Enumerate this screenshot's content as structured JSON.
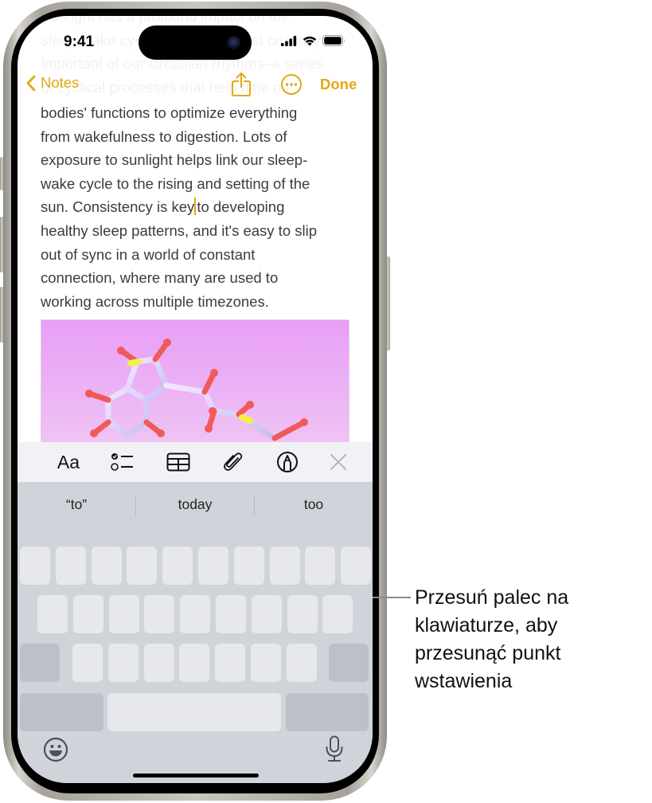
{
  "status_bar": {
    "time": "9:41",
    "icons": [
      "cellular-signal-icon",
      "wifi-icon",
      "battery-icon"
    ]
  },
  "nav": {
    "back_label": "Notes",
    "back_icon": "chevron-left-icon",
    "share_icon": "share-icon",
    "more_icon": "ellipsis-circle-icon",
    "done_label": "Done",
    "accent_color": "#E2A813"
  },
  "note": {
    "faded_lines": [
      "Sunlight has a profound impact on the",
      "sleep-wake cycle, one of the most crucially",
      "important of our circadian rhythms–a series",
      "of cyclical processes that help time our"
    ],
    "lines": [
      "bodies' functions to optimize everything",
      "from wakefulness to digestion. Lots of",
      "exposure to sunlight helps link our sleep-",
      "wake cycle to the rising and setting of the"
    ],
    "cursor_line": {
      "before": "sun. Consistency is key",
      "after": "to developing"
    },
    "lines_after": [
      "healthy sleep patterns, and it's easy to slip",
      "out of sync in a world of constant",
      "connection, where many are used to",
      "working across multiple timezones."
    ],
    "image": "molecule-illustration"
  },
  "format_toolbar": {
    "text_style_label": "Aa",
    "items": [
      "text-format-icon",
      "checklist-icon",
      "table-icon",
      "attachment-paperclip-icon",
      "markup-pen-icon",
      "close-icon"
    ]
  },
  "keyboard": {
    "suggestions": [
      "“to”",
      "today",
      "too"
    ],
    "state": "trackpad-mode (blank keys)",
    "row_counts": [
      10,
      9,
      7
    ],
    "emoji_icon": "emoji-icon",
    "mic_icon": "microphone-icon"
  },
  "callout": {
    "text_lines": [
      "Przesuń palec na",
      "klawiaturze, aby",
      "przesunąć punkt",
      "wstawienia"
    ]
  }
}
